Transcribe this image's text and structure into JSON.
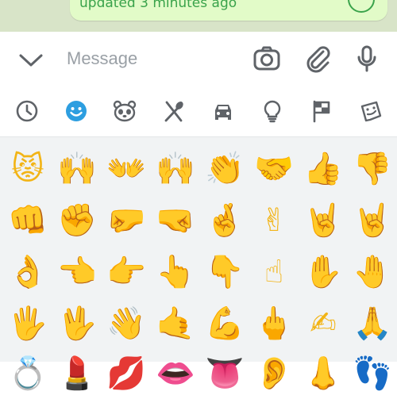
{
  "chat": {
    "status_text": "updated 3 minutes ago"
  },
  "input": {
    "placeholder": "Message"
  },
  "toolbar": {
    "collapse_icon": "chevron-down-icon",
    "camera_icon": "camera-icon",
    "attach_icon": "paperclip-icon",
    "mic_icon": "microphone-icon"
  },
  "categories": [
    {
      "icon": "clock-icon",
      "active": false
    },
    {
      "icon": "smiley-icon",
      "active": true
    },
    {
      "icon": "panda-icon",
      "active": false
    },
    {
      "icon": "fork-spoon-icon",
      "active": false
    },
    {
      "icon": "car-icon",
      "active": false
    },
    {
      "icon": "lightbulb-icon",
      "active": false
    },
    {
      "icon": "flag-icon",
      "active": false
    },
    {
      "icon": "sticker-icon",
      "active": false
    }
  ],
  "colors": {
    "accent": "#2d9ee0",
    "icon_gray": "#5f6368",
    "bubble_text": "#3aa34b",
    "emoji_yellow": "#f2b416"
  },
  "emoji_rows": [
    [
      "😾",
      "🙌",
      "👐",
      "🙌",
      "👏",
      "🤝",
      "👍",
      "👎"
    ],
    [
      "👊",
      "✊",
      "🤛",
      "🤜",
      "🤞",
      "✌",
      "🤘",
      "🤘"
    ],
    [
      "👌",
      "👈",
      "👉",
      "👆",
      "👇",
      "☝",
      "✋",
      "🤚"
    ],
    [
      "🖐",
      "🖖",
      "👋",
      "🤙",
      "💪",
      "🖕",
      "✍",
      "🙏"
    ],
    [
      "💍",
      "💄",
      "💋",
      "👄",
      "👅",
      "👂",
      "👃",
      "👣"
    ]
  ]
}
